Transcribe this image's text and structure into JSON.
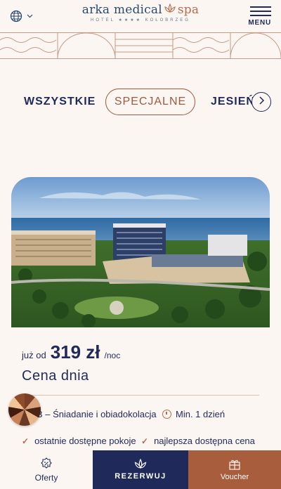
{
  "header": {
    "brand_main_a": "arka medical",
    "brand_main_b": "spa",
    "brand_sub": "HOTEL ★★★★ KOŁOBRZEG",
    "menu_label": "MENU"
  },
  "tabs": {
    "all": "WSZYSTKIE",
    "special": "SPECJALNE",
    "autumn": "JESIEŃ",
    "active": "SPECJALNE"
  },
  "offer": {
    "price_from": "już od",
    "price": "319 zł",
    "price_unit": "/noc",
    "title": "Cena dnia",
    "board": "B – Śniadanie i obiadokolacja",
    "min_stay": "Min. 1 dzień",
    "feature_1": "ostatnie dostępne pokoje",
    "feature_2": "najlepsza dostępna cena"
  },
  "nav": {
    "offers": "Oferty",
    "book": "REZERWUJ",
    "voucher": "Voucher"
  },
  "colors": {
    "navy": "#1f2a5a",
    "copper": "#a85d3d",
    "background": "#fbf6f1"
  }
}
